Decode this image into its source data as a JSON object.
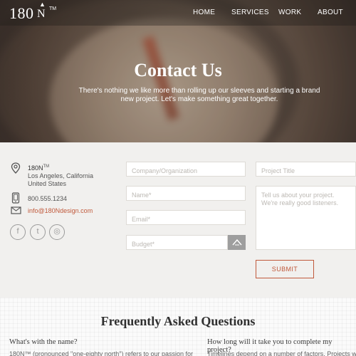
{
  "header": {
    "logo_text": "180",
    "logo_mark": "N",
    "logo_tm": "TM",
    "nav": [
      "HOME",
      "SERVICES",
      "WORK",
      "ABOUT"
    ]
  },
  "hero": {
    "title": "Contact Us",
    "subtitle": "There's nothing we like more than rolling up our sleeves and starting a brand new project.  Let's make something great together."
  },
  "contact_info": {
    "company": "180N",
    "company_tm": "TM",
    "city_state": "Los Angeles, California",
    "country": "United States",
    "phone": "800.555.1234",
    "email": "info@180Ndesign.com",
    "icons": [
      "location-pin-icon",
      "phone-icon",
      "email-icon"
    ],
    "social": [
      {
        "name": "facebook-icon",
        "glyph": "f"
      },
      {
        "name": "twitter-icon",
        "glyph": "t"
      },
      {
        "name": "instagram-icon",
        "glyph": "◎"
      }
    ]
  },
  "form": {
    "company_placeholder": "Company/Organization",
    "name_placeholder": "Name*",
    "email_placeholder": "Email*",
    "budget_placeholder": "Budget*",
    "project_title_placeholder": "Project Title",
    "message_placeholder": "Tell us about your project. We're really good listeners.",
    "submit_label": "SUBMIT"
  },
  "faq": {
    "title": "Frequently Asked Questions",
    "items": [
      {
        "question": "What's with the name?",
        "answer": "180N™ (pronounced \"one-eighty north\") refers to our passion for"
      },
      {
        "question": "How long will it take you to complete my project?",
        "answer": "Timelines depend on a number of factors. Projects with"
      }
    ]
  },
  "colors": {
    "accent": "#c0593b",
    "background": "#f1f0ee"
  }
}
